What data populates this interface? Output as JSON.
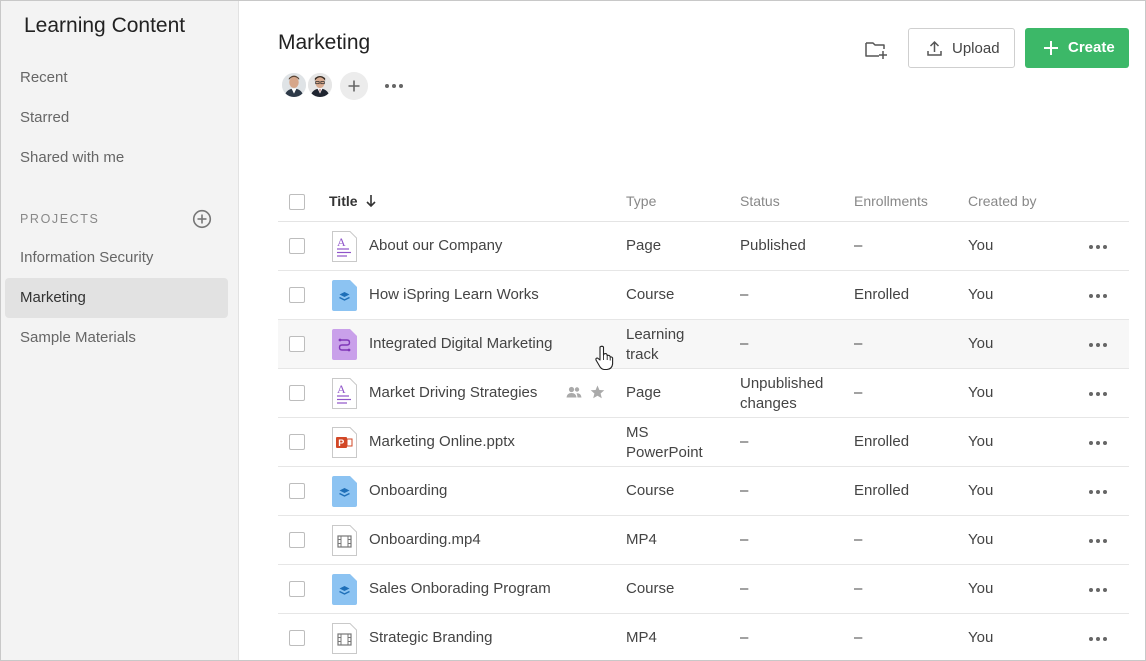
{
  "sidebar": {
    "title": "Learning Content",
    "nav": [
      {
        "label": "Recent"
      },
      {
        "label": "Starred"
      },
      {
        "label": "Shared with me"
      }
    ],
    "projects_heading": "PROJECTS",
    "projects": [
      {
        "label": "Information Security",
        "active": false
      },
      {
        "label": "Marketing",
        "active": true
      },
      {
        "label": "Sample Materials",
        "active": false
      }
    ]
  },
  "header": {
    "title": "Marketing",
    "upload_label": "Upload",
    "create_label": "Create",
    "accent_color": "#3cb868"
  },
  "table": {
    "columns": {
      "title": "Title",
      "type": "Type",
      "status": "Status",
      "enrollments": "Enrollments",
      "created_by": "Created by"
    },
    "rows": [
      {
        "title": "About our Company",
        "icon": "page-icon",
        "type": "Page",
        "status": "Published",
        "enrollments": "–",
        "created_by": "You"
      },
      {
        "title": "How iSpring Learn Works",
        "icon": "course-icon",
        "type": "Course",
        "status": "–",
        "enrollments": "Enrolled",
        "created_by": "You"
      },
      {
        "title": "Integrated Digital Marketing",
        "icon": "learning-track-icon",
        "type": "Learning track",
        "type_lines": [
          "Learning",
          "track"
        ],
        "status": "–",
        "enrollments": "–",
        "created_by": "You"
      },
      {
        "title": "Market Driving Strategies",
        "icon": "page-icon",
        "type": "Page",
        "status": "Unpublished changes",
        "status_lines": [
          "Unpublished",
          "changes"
        ],
        "enrollments": "–",
        "created_by": "You",
        "shared": true,
        "starred": true
      },
      {
        "title": "Marketing Online.pptx",
        "icon": "powerpoint-icon",
        "type": "MS PowerPoint",
        "type_lines": [
          "MS",
          "PowerPoint"
        ],
        "status": "–",
        "enrollments": "Enrolled",
        "created_by": "You"
      },
      {
        "title": "Onboarding",
        "icon": "course-icon",
        "type": "Course",
        "status": "–",
        "enrollments": "Enrolled",
        "created_by": "You"
      },
      {
        "title": "Onboarding.mp4",
        "icon": "video-icon",
        "type": "MP4",
        "status": "–",
        "enrollments": "–",
        "created_by": "You"
      },
      {
        "title": "Sales Onborading Program",
        "icon": "course-icon",
        "type": "Course",
        "status": "–",
        "enrollments": "–",
        "created_by": "You"
      },
      {
        "title": "Strategic Branding",
        "icon": "video-icon",
        "type": "MP4",
        "status": "–",
        "enrollments": "–",
        "created_by": "You"
      }
    ]
  }
}
